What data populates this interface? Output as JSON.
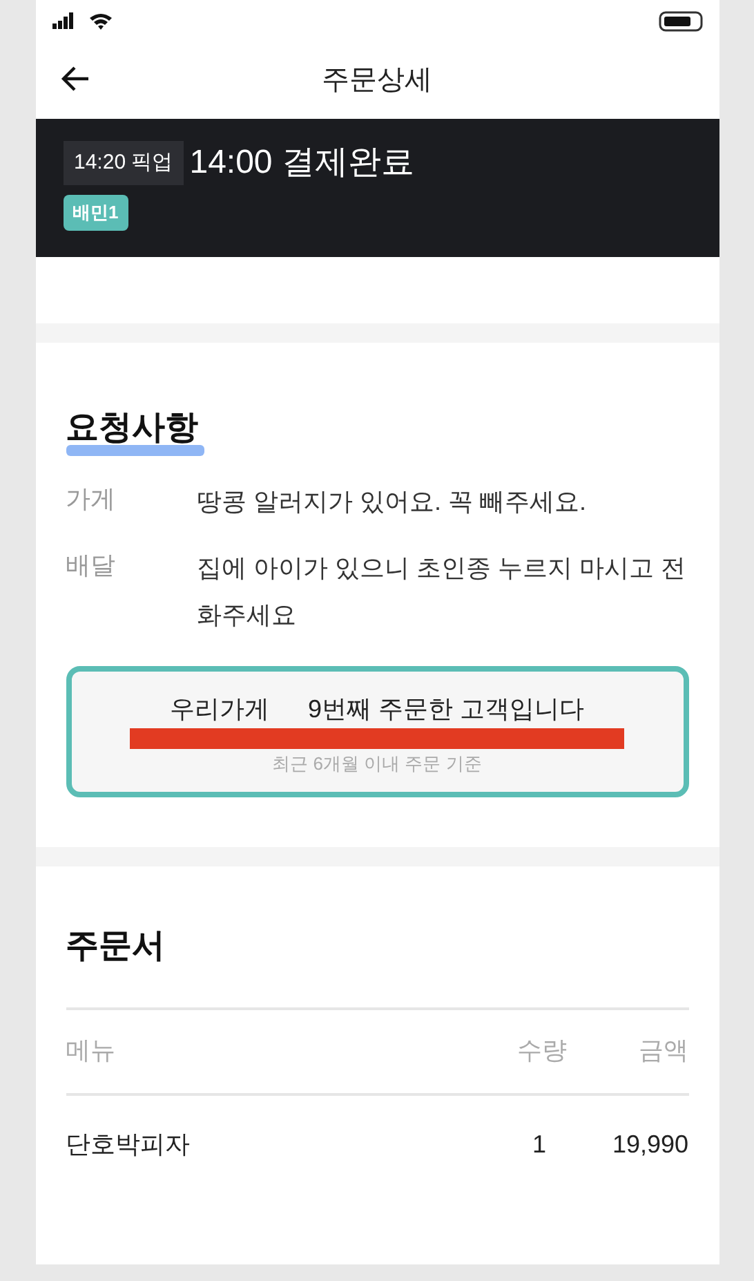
{
  "header": {
    "title": "주문상세"
  },
  "banner": {
    "pickup_time": "14:20 픽업",
    "status": "14:00 결제완료",
    "badge": "배민1"
  },
  "requests": {
    "title": "요청사항",
    "items": [
      {
        "label": "가게",
        "text": "땅콩 알러지가 있어요. 꼭 빼주세요."
      },
      {
        "label": "배달",
        "text": "집에 아이가 있으니 초인종 누르지 마시고 전화주세요"
      }
    ],
    "customer_note": {
      "store": "우리가게",
      "count": "9번째 주문한 고객입니다",
      "caption": "최근 6개월 이내 주문 기준"
    }
  },
  "order": {
    "title": "주문서",
    "columns": [
      "메뉴",
      "수량",
      "금액"
    ],
    "rows": [
      [
        "단호박피자",
        "1",
        "19,990"
      ]
    ]
  }
}
